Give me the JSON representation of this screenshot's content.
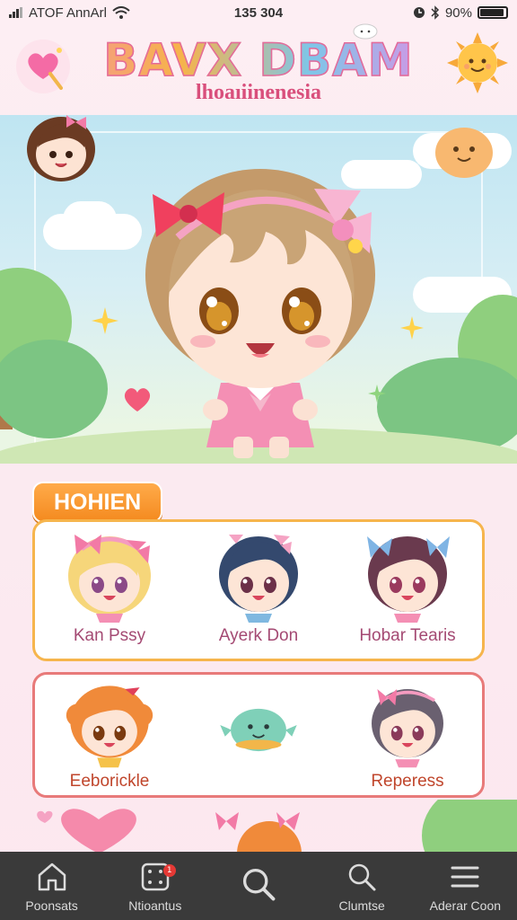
{
  "status_bar": {
    "carrier": "ATOF AnnArl",
    "time": "135 304",
    "battery": "90%"
  },
  "header": {
    "title": "BAVX DBAM",
    "subtitle": "lhoaıiinenesia"
  },
  "section": {
    "title": "HOHIEN"
  },
  "friends_row1": [
    {
      "name": "Kan Pssy"
    },
    {
      "name": "Ayerk Don"
    },
    {
      "name": "Hobar Tearis"
    }
  ],
  "friends_row2": [
    {
      "name": "Eeborickle"
    },
    {
      "name": ""
    },
    {
      "name": "Reperess"
    }
  ],
  "nav": {
    "items": [
      {
        "label": "Poonsats",
        "icon": "home-icon"
      },
      {
        "label": "Ntioantus",
        "icon": "dice-icon",
        "badge": "1"
      },
      {
        "label": "",
        "icon": "search-icon"
      },
      {
        "label": "Clumtse",
        "icon": "search-icon"
      },
      {
        "label": "Aderar Coon",
        "icon": "menu-icon"
      }
    ]
  },
  "colors": {
    "accent_orange": "#f48a1f",
    "accent_pink": "#e56a99",
    "nav_bg": "#3a3a3a"
  }
}
